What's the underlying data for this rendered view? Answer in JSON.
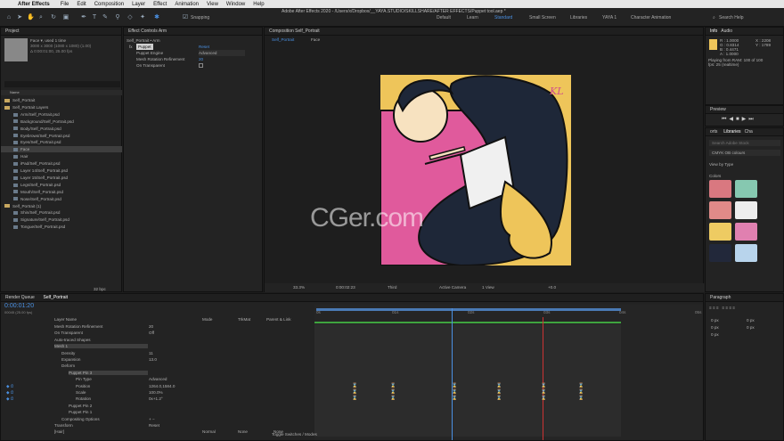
{
  "menubar": {
    "app": "After Effects",
    "items": [
      "File",
      "Edit",
      "Composition",
      "Layer",
      "Effect",
      "Animation",
      "View",
      "Window",
      "Help"
    ]
  },
  "window_title": "Adobe After Effects 2020 - /Users/x/Dropbox/__YAYA.STUDIO/SKILLSHARE/AFTER EFFECTS/Puppet tool.aep *",
  "toolbar": {
    "snapping": "Snapping",
    "workspaces": [
      "Default",
      "Learn",
      "Standard",
      "Small Screen",
      "Libraries",
      "YAYA 1",
      "Character Animation"
    ],
    "active_workspace": "Standard",
    "search": "Search Help"
  },
  "project": {
    "tab": "Project",
    "item_name": "Face ▾, used 1 time",
    "item_dims": "3000 x 3000 (1080 x 1080) (1.00)",
    "item_time": "Δ 0:00:01:00, 25.00 fps",
    "items": [
      "Self_Portrait",
      "Self_Portrait Layers",
      "Arm/Self_Portrait.psd",
      "Background/Self_Portrait.psd",
      "Body/Self_Portrait.psd",
      "Eyebrows/Self_Portrait.psd",
      "Eyes/Self_Portrait.psd",
      "Face",
      "Hair",
      "iPad/Self_Portrait.psd",
      "Layer 14/Self_Portrait.psd",
      "Layer 15/Self_Portrait.psd",
      "Legs/Self_Portrait.psd",
      "Mouth/Self_Portrait.psd",
      "Nose/Self_Portrait.psd",
      "Self_Portrait (1)",
      "Shin/Self_Portrait.psd",
      "Signature/Self_Portrait.psd",
      "Tongue/Self_Portrait.psd"
    ],
    "bpc": "32 bpc"
  },
  "effects": {
    "tab": "Effect Controls Arm",
    "header": "Self_Portrait • Arm",
    "fx": "fx",
    "fx_name": "Puppet",
    "reset": "Reset",
    "engine_label": "Puppet Engine",
    "engine_value": "Advanced",
    "mesh_label": "Mesh Rotation Refinement",
    "mesh_value": "20",
    "transparent_label": "On Transparent"
  },
  "composition": {
    "tab": "Composition Self_Portrait",
    "subtabs": [
      "Self_Portrait",
      "Face"
    ],
    "zoom": "33.3%",
    "timecode": "0:00:02:23",
    "view": "Third",
    "camera": "Active Camera",
    "views": "1 View",
    "exposure": "+0.0",
    "watermark": "CGer.com",
    "signature": "KL"
  },
  "info": {
    "tabs": [
      "Info",
      "Audio"
    ],
    "r": "R : 1.0000",
    "g": "G : 0.8314",
    "b": "B : 0.4471",
    "a": "A : 1.0000",
    "x": "X : 2208",
    "y": "Y : 1789",
    "playing": "Playing from RAM: 100 of 100",
    "fps": "fps: 25 (realtime)"
  },
  "preview": {
    "tab": "Preview"
  },
  "libraries": {
    "tabs": [
      "orts",
      "Libraries",
      "Cha"
    ],
    "search": "Search Adobe Stock",
    "library": "CMYK OB colours",
    "view": "View by Type",
    "section": "Colors",
    "swatches": [
      "#d97880",
      "#86c8b0",
      "#e08a88",
      "#eeeeee",
      "#eecb62",
      "#e080b0",
      "#22283a",
      "#b8d4ec"
    ]
  },
  "paragraph": {
    "tab": "Paragraph",
    "fields": [
      "0 px",
      "0 px",
      "0 px",
      "0 px",
      "0 px"
    ]
  },
  "timeline": {
    "tabs": [
      "Render Queue",
      "Self_Portrait"
    ],
    "timecode": "0:00:01:20",
    "frames": "00045 (25.00 fps)",
    "columns": {
      "layer": "Layer Name",
      "mode": "Mode",
      "trkmat": "TrkMat",
      "parent": "Parent & Link"
    },
    "rows": [
      {
        "label": "Mesh Rotation Refinement",
        "value": "20",
        "indent": 0
      },
      {
        "label": "On Transparent",
        "value": "Off",
        "indent": 0
      },
      {
        "label": "Auto-traced Shapes",
        "value": "",
        "indent": 0
      },
      {
        "label": "Mesh 1",
        "value": "",
        "indent": 0
      },
      {
        "label": "Density",
        "value": "11",
        "indent": 1
      },
      {
        "label": "Expansion",
        "value": "13.0",
        "indent": 1
      },
      {
        "label": "Deform",
        "value": "",
        "indent": 1
      },
      {
        "label": "Puppet Pin 3",
        "value": "",
        "indent": 2
      },
      {
        "label": "Pin Type",
        "value": "Advanced",
        "indent": 3
      },
      {
        "label": "Position",
        "value": "1264.0,1584.0",
        "indent": 3
      },
      {
        "label": "Scale",
        "value": "100.0%",
        "indent": 3
      },
      {
        "label": "Rotation",
        "value": "0x+1.2°",
        "indent": 3
      },
      {
        "label": "Puppet Pin 2",
        "value": "",
        "indent": 2
      },
      {
        "label": "Puppet Pin 1",
        "value": "",
        "indent": 2
      },
      {
        "label": "Compositing Options",
        "value": "+ −",
        "indent": 1
      },
      {
        "label": "Transform",
        "value": "Reset",
        "indent": 0
      },
      {
        "label": "[Hair]",
        "value": "",
        "indent": 0
      }
    ],
    "ruler": [
      "0s",
      "01s",
      "02s",
      "03s",
      "04s",
      "05s"
    ],
    "mode_normal": "Normal",
    "parent_none": "None",
    "toggle": "Toggle Switches / Modes"
  }
}
